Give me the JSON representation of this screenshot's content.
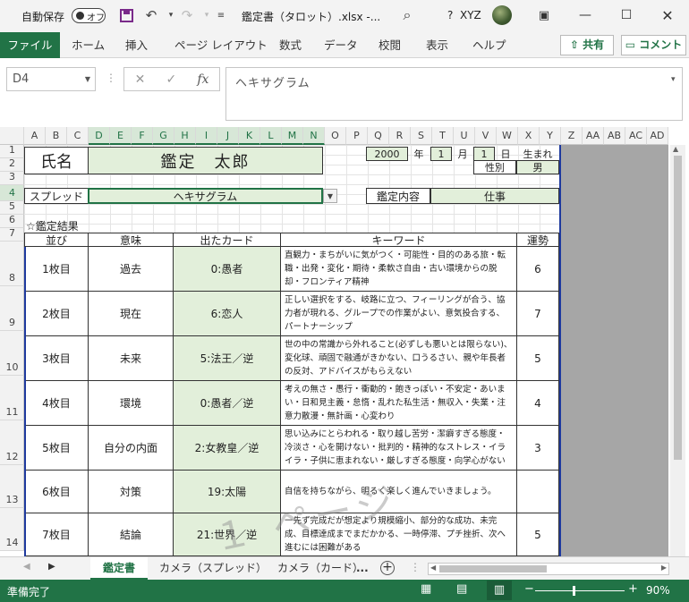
{
  "titlebar": {
    "autosave_label": "自動保存",
    "autosave_state": "オフ",
    "filename": "鑑定書（タロット）.xlsx  -...",
    "user": "XYZ",
    "help": "?"
  },
  "ribbon": {
    "tabs": [
      "ファイル",
      "ホーム",
      "挿入",
      "ページ レイアウト",
      "数式",
      "データ",
      "校閲",
      "表示",
      "ヘルプ"
    ],
    "share_label": "共有",
    "comment_label": "コメント"
  },
  "formula_bar": {
    "name_box": "D4",
    "content": "ヘキサグラム",
    "fx": "fx"
  },
  "columns": [
    "A",
    "B",
    "C",
    "D",
    "E",
    "F",
    "G",
    "H",
    "I",
    "J",
    "K",
    "L",
    "M",
    "N",
    "O",
    "P",
    "Q",
    "R",
    "S",
    "T",
    "U",
    "V",
    "W",
    "X",
    "Y",
    "Z",
    "AA",
    "AB",
    "AC",
    "AD"
  ],
  "rows": [
    "1",
    "2",
    "3",
    "4",
    "5",
    "6",
    "7",
    "8",
    "9",
    "10",
    "11",
    "12",
    "13",
    "14"
  ],
  "sheet": {
    "name_label": "氏名",
    "name_value": "鑑定　太郎",
    "birth_year": "2000",
    "year_unit": "年",
    "birth_month": "1",
    "month_unit": "月",
    "birth_day": "1",
    "day_unit": "日",
    "born_label": "生まれ",
    "gender_label": "性別",
    "gender_value": "男",
    "spread_label": "スプレッド",
    "spread_value": "ヘキサグラム",
    "content_label": "鑑定内容",
    "content_value": "仕事",
    "result_heading": "☆鑑定結果",
    "headers": {
      "order": "並び",
      "meaning": "意味",
      "card": "出たカード",
      "keyword": "キーワード",
      "fortune": "運勢"
    },
    "results": [
      {
        "order": "1枚目",
        "meaning": "過去",
        "card": "0:愚者",
        "keyword": "直観力・まちがいに気がつく・可能性・目的のある旅・転職・出発・変化・期待・柔軟さ自由・古い環境からの脱却・フロンティア精神",
        "fortune": "6"
      },
      {
        "order": "2枚目",
        "meaning": "現在",
        "card": "6:恋人",
        "keyword": "正しい選択をする、岐路に立つ、フィーリングが合う、協力者が現れる、グループでの作業がよい、意気投合する、パートナーシップ",
        "fortune": "7"
      },
      {
        "order": "3枚目",
        "meaning": "未来",
        "card": "5:法王／逆",
        "keyword": "世の中の常識から外れること(必ずしも悪いとは限らない)、変化球、頑固で融通がきかない、口うるさい、親や年長者の反対、アドバイスがもらえない",
        "fortune": "5"
      },
      {
        "order": "4枚目",
        "meaning": "環境",
        "card": "0:愚者／逆",
        "keyword": "考えの無さ・愚行・衝動的・飽きっぽい・不安定・あいまい・日和見主義・怠惰・乱れた私生活・無収入・失業・注意力散漫・無計画・心変わり",
        "fortune": "4"
      },
      {
        "order": "5枚目",
        "meaning": "自分の内面",
        "card": "2:女教皇／逆",
        "keyword": "思い込みにとらわれる・取り越し苦労・潔癖すぎる態度・冷淡さ・心を開けない・批判的・精神的なストレス・イライラ・子供に恵まれない・厳しすぎる態度・向学心がない",
        "fortune": "3"
      },
      {
        "order": "6枚目",
        "meaning": "対策",
        "card": "19:太陽",
        "keyword": "自信を持ちながら、明るく楽しく進んでいきましょう。",
        "fortune": ""
      },
      {
        "order": "7枚目",
        "meaning": "結論",
        "card": "21:世界／逆",
        "keyword": "一先ず完成だが想定より規模縮小、部分的な成功、未完成、目標達成までまだかかる、一時停滞、プチ挫折、次へ進むには困難がある",
        "fortune": "5"
      }
    ],
    "watermark": "１ ページ"
  },
  "sheet_tabs": [
    "鑑定書",
    "カメラ（スプレッド）",
    "カメラ（カード）",
    "..."
  ],
  "status": {
    "ready": "準備完了",
    "zoom": "90%"
  }
}
